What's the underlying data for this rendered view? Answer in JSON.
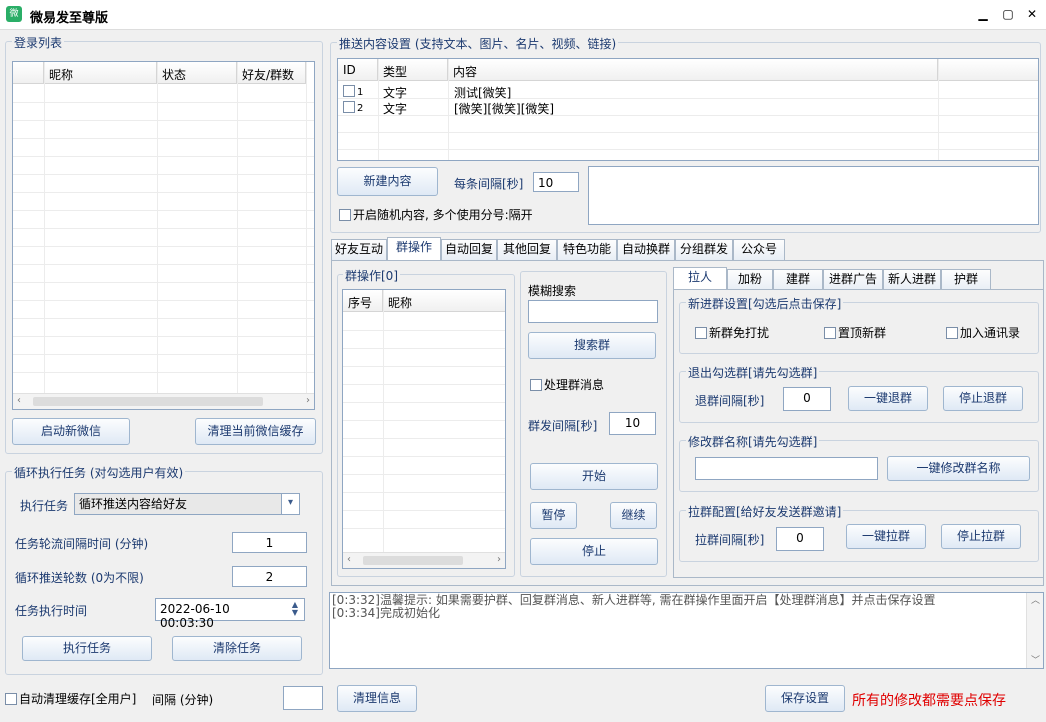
{
  "window": {
    "title": "微易发至尊版",
    "minimize": "▁",
    "maximize": "▢",
    "close": "✕"
  },
  "login": {
    "legend": "登录列表",
    "columns": [
      "昵称",
      "状态",
      "好友/群数"
    ],
    "start_btn": "启动新微信",
    "clear_btn": "清理当前微信缓存"
  },
  "loop": {
    "legend": "循环执行任务 (对勾选用户有效)",
    "task_label": "执行任务",
    "task_value": "循环推送内容给好友",
    "interval_label": "任务轮流间隔时间 (分钟)",
    "interval_value": "1",
    "rounds_label": "循环推送轮数 (0为不限)",
    "rounds_value": "2",
    "time_label": "任务执行时间",
    "time_value": "2022-06-10 00:03:30",
    "exec_btn": "执行任务",
    "clear_btn": "清除任务"
  },
  "bottom_left": {
    "auto_clear": "自动清理缓存[全用户]",
    "interval_label": "间隔 (分钟)",
    "interval_value": ""
  },
  "push": {
    "legend": "推送内容设置 (支持文本、图片、名片、视频、链接)",
    "columns": [
      "ID",
      "类型",
      "内容"
    ],
    "rows": [
      {
        "id": "1",
        "type": "文字",
        "content": "测试[微笑]"
      },
      {
        "id": "2",
        "type": "文字",
        "content": "[微笑][微笑][微笑]"
      }
    ],
    "new_btn": "新建内容",
    "interval_label": "每条间隔[秒]",
    "interval_value": "10",
    "random_label": "开启随机内容, 多个使用分号:隔开"
  },
  "tabs": [
    "好友互动",
    "群操作",
    "自动回复",
    "其他回复",
    "特色功能",
    "自动换群",
    "分组群发",
    "公众号"
  ],
  "group_op": {
    "legend": "群操作[0]",
    "columns": [
      "序号",
      "昵称"
    ],
    "fuzzy_label": "模糊搜索",
    "fuzzy_value": "",
    "search_btn": "搜索群",
    "process_label": "处理群消息",
    "send_interval_label": "群发间隔[秒]",
    "send_interval_value": "10",
    "start_btn": "开始",
    "pause_btn": "暂停",
    "continue_btn": "继续",
    "stop_btn": "停止"
  },
  "subtabs": [
    "拉人",
    "加粉",
    "建群",
    "进群广告",
    "新人进群",
    "护群"
  ],
  "newgroup": {
    "legend": "新进群设置[勾选后点击保存]",
    "opt1": "新群免打扰",
    "opt2": "置顶新群",
    "opt3": "加入通讯录"
  },
  "quit": {
    "legend": "退出勾选群[请先勾选群]",
    "interval_label": "退群间隔[秒]",
    "interval_value": "0",
    "quit_btn": "一键退群",
    "stop_btn": "停止退群"
  },
  "rename": {
    "legend": "修改群名称[请先勾选群]",
    "value": "",
    "btn": "一键修改群名称"
  },
  "pull": {
    "legend": "拉群配置[给好友发送群邀请]",
    "interval_label": "拉群间隔[秒]",
    "interval_value": "0",
    "pull_btn": "一键拉群",
    "stop_btn": "停止拉群"
  },
  "log": {
    "lines": [
      "[0:3:32]温馨提示: 如果需要护群、回复群消息、新人进群等, 需在群操作里面开启【处理群消息】并点击保存设置",
      "[0:3:34]完成初始化"
    ]
  },
  "footer": {
    "clear_btn": "清理信息",
    "save_btn": "保存设置",
    "notice": "所有的修改都需要点保存",
    "notice_color": "#e00000"
  }
}
